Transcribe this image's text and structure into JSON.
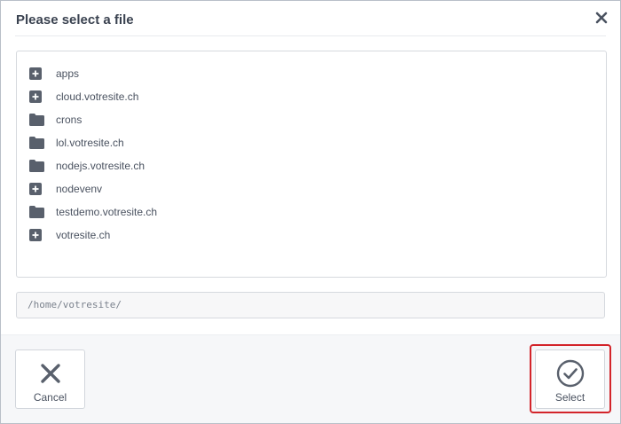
{
  "dialog": {
    "title": "Please select a file"
  },
  "tree": {
    "items": [
      {
        "label": "apps",
        "icon": "expand-plus-icon"
      },
      {
        "label": "cloud.votresite.ch",
        "icon": "expand-plus-icon"
      },
      {
        "label": "crons",
        "icon": "folder-icon"
      },
      {
        "label": "lol.votresite.ch",
        "icon": "folder-icon"
      },
      {
        "label": "nodejs.votresite.ch",
        "icon": "folder-icon"
      },
      {
        "label": "nodevenv",
        "icon": "expand-plus-icon"
      },
      {
        "label": "testdemo.votresite.ch",
        "icon": "folder-icon"
      },
      {
        "label": "votresite.ch",
        "icon": "expand-plus-icon"
      }
    ]
  },
  "path": {
    "value": "/home/votresite/"
  },
  "footer": {
    "cancel_label": "Cancel",
    "select_label": "Select"
  },
  "colors": {
    "icon": "#59606c",
    "highlight": "#d3242a",
    "footer_bg": "#f6f7f9"
  }
}
